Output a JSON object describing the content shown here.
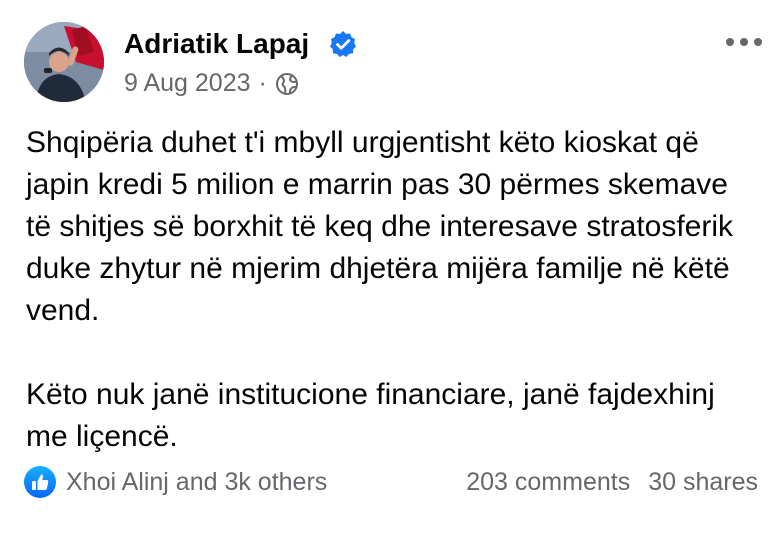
{
  "post": {
    "author": "Adriatik Lapaj",
    "date": "9 Aug 2023",
    "separator": "·",
    "audience_icon": "globe-icon",
    "verified_icon": "verified-badge-icon",
    "more_icon": "more-options-icon",
    "paragraphs": [
      "Shqipëria duhet t'i mbyll urgjentisht këto kioskat që japin kredi 5 milion e marrin pas 30 përmes skemave të shitjes së borxhit të keq dhe interesave stratosferik duke zhytur në mjerim dhjetëra mijëra familje në këtë vend.",
      "Këto nuk janë institucione financiare, janë fajdexhinj me liçencë."
    ],
    "reactions_text": "Xhoi Alinj and 3k others",
    "reaction_icon": "like-icon",
    "comments": "203 comments",
    "shares": "30 shares"
  },
  "colors": {
    "primary_text": "#050505",
    "secondary_text": "#65676b",
    "accent": "#1877f2"
  }
}
